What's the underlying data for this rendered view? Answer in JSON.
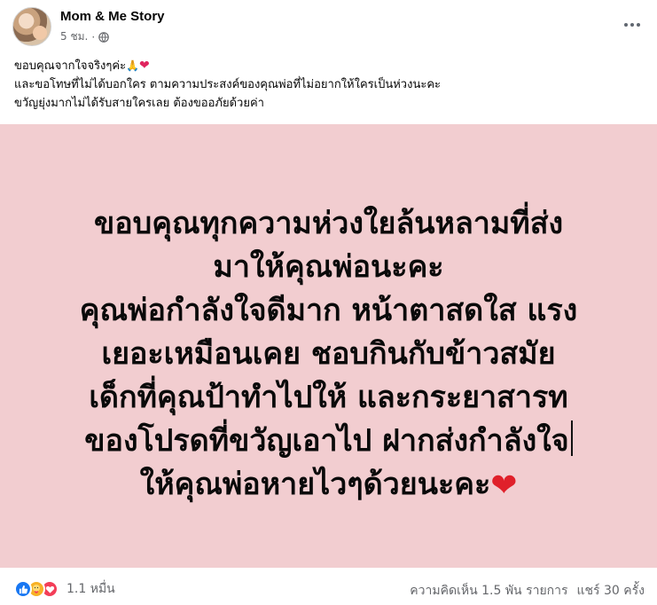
{
  "post": {
    "page_name": "Mom & Me Story",
    "time": "5 ชม.",
    "separator": "·",
    "privacy_icon": "globe-icon"
  },
  "caption": {
    "line1": "ขอบคุณจากใจจริงๆค่ะ",
    "line1_emoji_pray": "🙏",
    "line1_emoji_heart": "❤",
    "line2": "และขอโทษที่ไม่ได้บอกใคร ตามความประสงค์ของคุณพ่อที่ไม่อยากให้ใครเป็นห่วงนะคะ",
    "line3": "ขวัญยุ่งมากไม่ได้รับสายใครเลย ต้องขออภัยด้วยค่า"
  },
  "image": {
    "background": "#f2cdd0",
    "lines": [
      "ขอบคุณทุกความห่วงใยล้นหลามที่ส่ง",
      "มาให้คุณพ่อนะคะ",
      "คุณพ่อกำลังใจดีมาก หน้าตาสดใส แรง",
      "เยอะเหมือนเคย ชอบกินกับข้าวสมัย",
      "เด็กที่คุณป้าทำไปให้ และกระยาสารท",
      "ของโปรดที่ขวัญเอาไป ฝากส่งกำลังใจ",
      "ให้คุณพ่อหายไวๆด้วยนะคะ"
    ],
    "heart_icon": "heart-icon"
  },
  "footer": {
    "reaction_icons": [
      "like-icon",
      "care-icon",
      "love-icon"
    ],
    "reaction_count": "1.1 หมื่น",
    "comments": "ความคิดเห็น 1.5 พัน รายการ",
    "shares": "แชร์ 30 ครั้ง"
  },
  "colors": {
    "like": "#1877f2",
    "care": "#f7b125",
    "love": "#f33e58",
    "muted_text": "#65676b"
  }
}
